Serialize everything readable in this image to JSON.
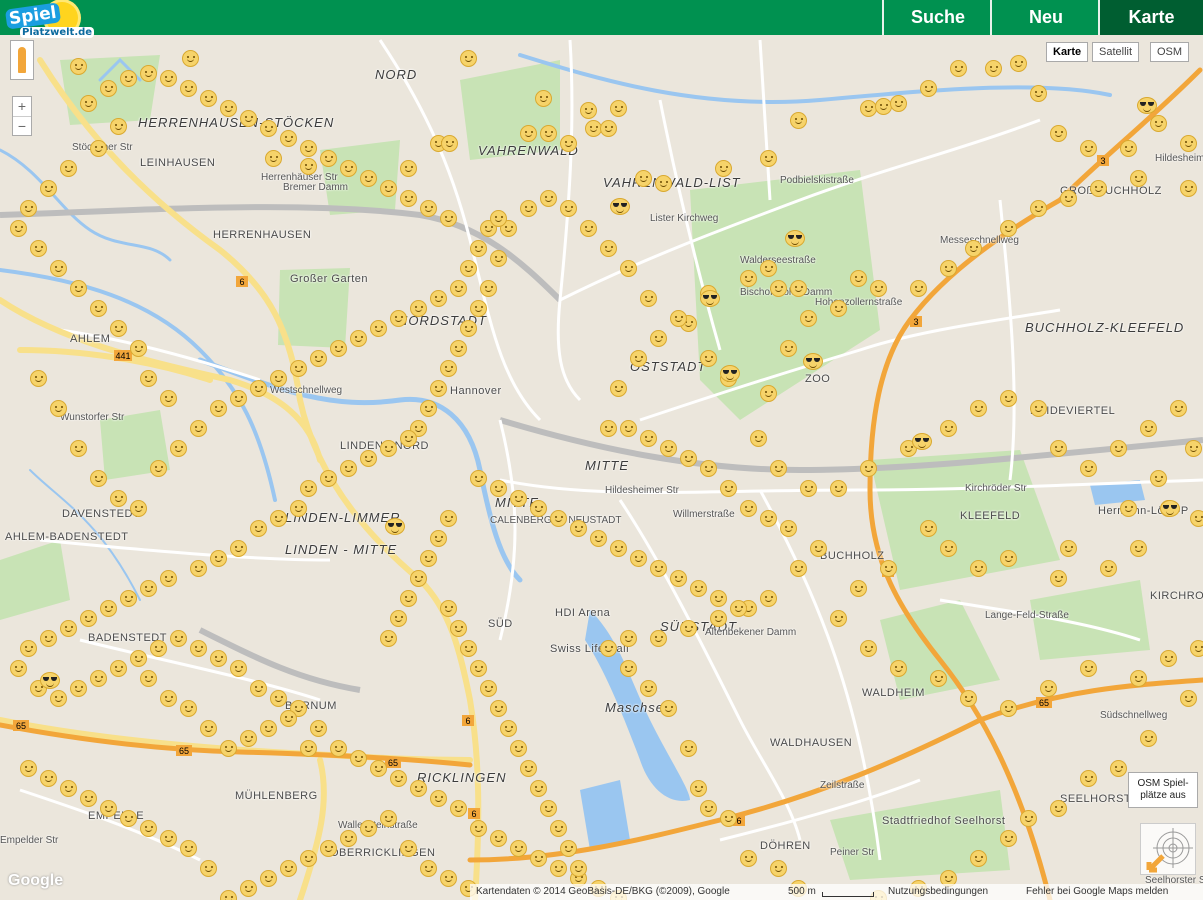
{
  "logo": {
    "line1": "Spiel",
    "line2": "Platzwelt.de"
  },
  "nav": {
    "search_label": "Suche",
    "new_label": "Neu",
    "map_label": "Karte"
  },
  "map_types": {
    "map_label": "Karte",
    "satellite_label": "Satellit",
    "osm_label": "OSM"
  },
  "zoom": {
    "in_label": "+",
    "out_label": "−"
  },
  "osm_toggle": {
    "line1": "OSM Spiel-",
    "line2": "plätze aus"
  },
  "google_logo": "Google",
  "footer": {
    "attribution": "Kartendaten © 2014 GeoBasis-DE/BKG (©2009), Google",
    "scale_label": "500 m",
    "terms_label": "Nutzungsbedingungen",
    "report_label": "Fehler bei Google Maps melden"
  },
  "colors": {
    "header": "#009150",
    "nav_active": "#005e31",
    "smiley": "#f6d36a",
    "highway": "#f2a63a",
    "road": "#f8e08a",
    "water": "#9ac6f0",
    "park": "#c8e3b5"
  },
  "district_labels": {
    "nord": "NORD",
    "herrenhausen": "HERRENHAUSEN-STÖCKEN",
    "leinhausen": "LEINHAUSEN",
    "vahrenwald": "VAHRENWALD",
    "vahrenwald_list": "VAHRENWALD-LIST",
    "gross_buchholz": "GROß BUCHHOLZ",
    "herrenhausen2": "HERRENHAUSEN",
    "grosser_garten": "Großer Garten",
    "nordstadt": "NORDSTADT",
    "oststadt": "OSTSTADT",
    "buchholz_kleefeld": "BUCHHOLZ-KLEEFELD",
    "ahlem_lbl": "AHLEM",
    "mitte": "MITTE",
    "mitte2": "MITTE",
    "calenberger": "CALENBERGER NEUSTADT",
    "heideviertel": "HEIDEVIERTEL",
    "davenstedt": "DAVENSTEDT",
    "linden_limmer": "LINDEN-LIMMER",
    "linden_mitte": "LINDEN - MITTE",
    "linden_nord": "LINDEN - NORD",
    "kleefeld": "KLEEFELD",
    "ahlem_badenstedt": "AHLEM-BADENSTEDT",
    "badenstedt": "BADENSTEDT",
    "hdi_arena": "HDI Arena",
    "swiss_life": "Swiss Life Hall",
    "suedstadt": "SÜDSTADT",
    "kirchrode": "KIRCHRODE",
    "maschsee": "Maschsee",
    "bornum": "BORNUM",
    "waldheim": "WALDHEIM",
    "waldhausen": "WALDHAUSEN",
    "ricklingen": "RICKLINGEN",
    "muehlenberg": "MÜHLENBERG",
    "empelde": "EMPELDE",
    "oberricklingen": "OBERRICKLINGEN",
    "seelhorst": "SEELHORST",
    "stadtfriedhof": "Stadtfriedhof Seelhorst",
    "doehren": "DÖHREN",
    "hermann_loens": "Hermann-Löns-P",
    "zoo": "ZOO",
    "hannover": "Hannover",
    "sued": "SÜD",
    "buchholz2": "BUCHHOLZ"
  },
  "street_labels": {
    "westschnellweg": "Westschnellweg",
    "messeschnellweg": "Messeschnellweg",
    "suedschnellweg": "Südschnellweg",
    "podbielski": "Podbielskistraße",
    "walderseestr": "Walderseestraße",
    "hildesheimer": "Hildesheimer Str",
    "kirchroeder": "Kirchröder Str",
    "langefeld": "Lange-Feld-Straße",
    "willmerstr": "Willmerstraße",
    "wallensteinstr": "Wallensteinstraße",
    "stoecken_str": "Stöckener Str",
    "listerkirchweg": "Lister Kirchweg",
    "bremer": "Bremer Damm",
    "hohenzollern": "Hohenzollernstraße",
    "wunstorfer": "Wunstorfer Str",
    "empelder_str": "Empelder Str",
    "bischofsholer": "Bischofsholer Damm",
    "heerenhausen_str": "Herrenhäuser Str",
    "hildesheimer2": "Hildesheimer Straße",
    "altenbekener": "Altenbekener Damm",
    "zeilstr": "Zeilstraße",
    "peiner": "Peiner Str",
    "seelhorster": "Seelhorster Str"
  }
}
